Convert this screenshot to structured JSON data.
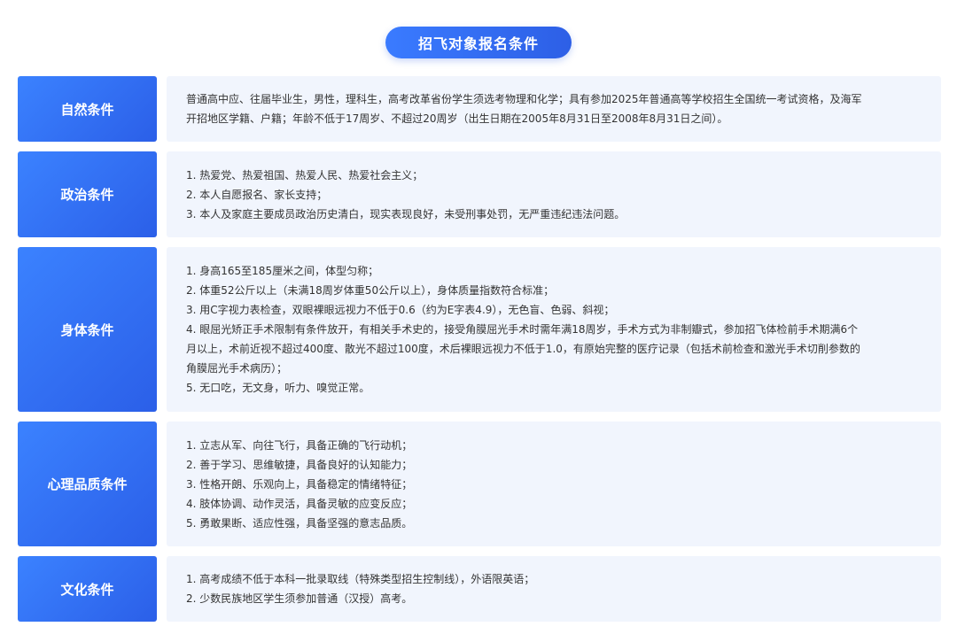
{
  "title": "招飞对象报名条件",
  "sections": [
    {
      "label": "自然条件",
      "lines": [
        "普通高中应、往届毕业生，男性，理科生，高考改革省份学生须选考物理和化学；具有参加2025年普通高等学校招生全国统一考试资格，及海军",
        "开招地区学籍、户籍；年龄不低于17周岁、不超过20周岁（出生日期在2005年8月31日至2008年8月31日之间）。"
      ]
    },
    {
      "label": "政治条件",
      "lines": [
        "1. 热爱党、热爱祖国、热爱人民、热爱社会主义；",
        "2. 本人自愿报名、家长支持；",
        "3. 本人及家庭主要成员政治历史清白，现实表现良好，未受刑事处罚，无严重违纪违法问题。"
      ]
    },
    {
      "label": "身体条件",
      "lines": [
        "1. 身高165至185厘米之间，体型匀称；",
        "2. 体重52公斤以上（未满18周岁体重50公斤以上），身体质量指数符合标准；",
        "3. 用C字视力表检查，双眼裸眼远视力不低于0.6（约为E字表4.9），无色盲、色弱、斜视；",
        "4. 眼屈光矫正手术限制有条件放开，有相关手术史的，接受角膜屈光手术时需年满18周岁，手术方式为非制瓣式，参加招飞体检前手术期满6个",
        "月以上，术前近视不超过400度、散光不超过100度，术后裸眼远视力不低于1.0，有原始完整的医疗记录（包括术前检查和激光手术切削参数的",
        "角膜屈光手术病历）；",
        "5. 无口吃，无文身，听力、嗅觉正常。"
      ]
    },
    {
      "label": "心理品质条件",
      "lines": [
        "1. 立志从军、向往飞行，具备正确的飞行动机；",
        "2. 善于学习、思维敏捷，具备良好的认知能力；",
        "3. 性格开朗、乐观向上，具备稳定的情绪特征；",
        "4. 肢体协调、动作灵活，具备灵敏的应变反应；",
        "5. 勇敢果断、适应性强，具备坚强的意志品质。"
      ]
    },
    {
      "label": "文化条件",
      "lines": [
        "1. 高考成绩不低于本科一批录取线（特殊类型招生控制线），外语限英语；",
        "2. 少数民族地区学生须参加普通（汉授）高考。"
      ]
    }
  ]
}
